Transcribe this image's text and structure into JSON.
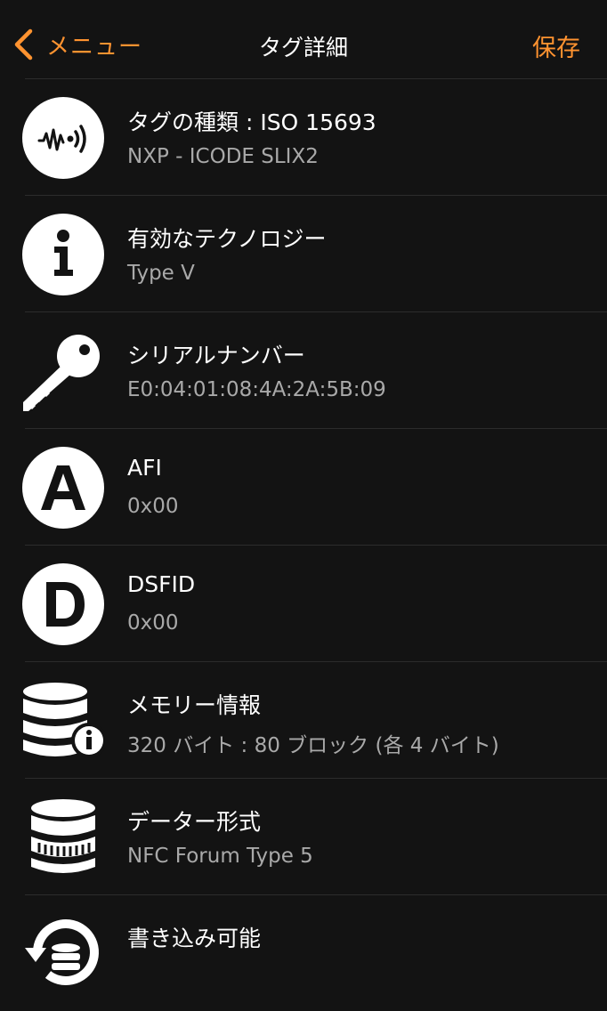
{
  "nav": {
    "back_label": "メニュー",
    "title": "タグ詳細",
    "save_label": "保存"
  },
  "colors": {
    "accent": "#ff9330",
    "background": "#131313",
    "divider": "#2c2c2c",
    "subtitle": "#a9a9a9"
  },
  "rows": [
    {
      "icon": "nfc-tag-icon",
      "title": "タグの種類 : ISO 15693",
      "subtitle": "NXP - ICODE SLIX2"
    },
    {
      "icon": "info-icon",
      "title": "有効なテクノロジー",
      "subtitle": "Type V"
    },
    {
      "icon": "key-icon",
      "title": "シリアルナンバー",
      "subtitle": "E0:04:01:08:4A:2A:5B:09"
    },
    {
      "icon": "letter-a-icon",
      "title": "AFI",
      "subtitle": "0x00"
    },
    {
      "icon": "letter-d-icon",
      "title": "DSFID",
      "subtitle": "0x00"
    },
    {
      "icon": "database-info-icon",
      "title": "メモリー情報",
      "subtitle": "320 バイト : 80 ブロック (各 4 バイト)"
    },
    {
      "icon": "database-format-icon",
      "title": "データー形式",
      "subtitle": "NFC Forum Type 5"
    },
    {
      "icon": "database-write-icon",
      "title": "書き込み可能",
      "subtitle": ""
    }
  ]
}
